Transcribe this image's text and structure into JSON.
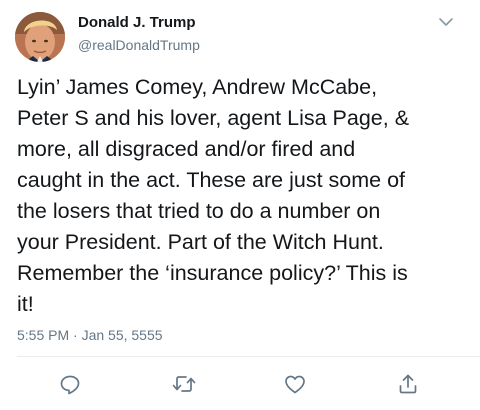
{
  "tweet": {
    "author_name": "Donald J. Trump",
    "author_handle": "@realDonaldTrump",
    "text": "Lyin’ James Comey, Andrew McCabe,\nPeter S and his lover, agent Lisa Page, &\nmore, all disgraced and/or fired and\ncaught in the act. These are just some of\nthe losers that tried to do a number on\nyour President. Part of the Witch Hunt.\nRemember the ‘insurance policy?’ This is\nit!",
    "timestamp": "5:55 PM · Jan 55, 5555"
  },
  "icons": {
    "menu": "chevron-down-icon",
    "reply": "reply-icon",
    "retweet": "retweet-icon",
    "like": "heart-icon",
    "share": "share-icon"
  },
  "colors": {
    "text": "#14171a",
    "secondary_text": "#657786",
    "icon": "#657786",
    "divider": "#e6ecf0"
  }
}
